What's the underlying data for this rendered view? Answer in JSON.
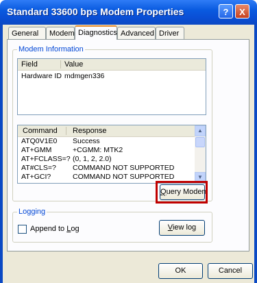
{
  "window": {
    "title": "Standard 33600 bps Modem Properties"
  },
  "titlebar": {
    "help_glyph": "?",
    "close_glyph": "X"
  },
  "tabs": [
    {
      "label": "General"
    },
    {
      "label": "Modem"
    },
    {
      "label": "Diagnostics",
      "active": true
    },
    {
      "label": "Advanced"
    },
    {
      "label": "Driver"
    }
  ],
  "modem_info": {
    "legend": "Modem Information",
    "columns": [
      "Field",
      "Value"
    ],
    "rows": [
      {
        "field": "Hardware ID",
        "value": "mdmgen336"
      }
    ],
    "commands": {
      "columns": [
        "Command",
        "Response"
      ],
      "rows": [
        {
          "command": "ATQ0V1E0",
          "response": "Success"
        },
        {
          "command": "AT+GMM",
          "response": "+CGMM: MTK2"
        },
        {
          "command": "AT+FCLASS=?",
          "response": "(0, 1, 2, 2.0)"
        },
        {
          "command": "AT#CLS=?",
          "response": "COMMAND NOT SUPPORTED"
        },
        {
          "command": "AT+GCI?",
          "response": "COMMAND NOT SUPPORTED"
        }
      ]
    },
    "query_button": {
      "accel": "Q",
      "rest": "uery Modem"
    }
  },
  "logging": {
    "legend": "Logging",
    "append_checkbox": {
      "accel": "L",
      "prefix": "Append to ",
      "rest": "og",
      "checked": false
    },
    "view_log_button": {
      "accel": "V",
      "rest": "iew log"
    }
  },
  "footer": {
    "ok_label": "OK",
    "cancel_label": "Cancel"
  }
}
